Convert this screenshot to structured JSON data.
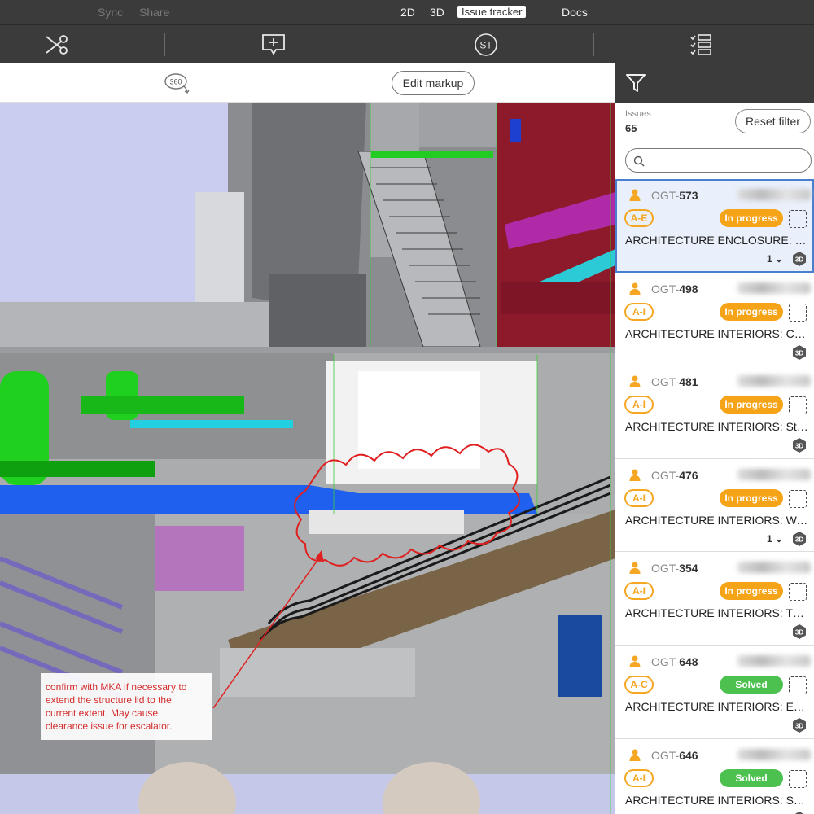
{
  "topnav": {
    "sync": "Sync",
    "share": "Share",
    "modes": [
      "2D",
      "3D",
      "Issue tracker",
      "Docs"
    ],
    "active_mode": "Issue tracker"
  },
  "toolbar": {
    "icons": [
      "scissors-icon",
      "add-comment-icon",
      "st-icon",
      "checklist-icon"
    ],
    "st_label": "ST"
  },
  "subbar": {
    "view360_label": "360",
    "edit_markup": "Edit markup"
  },
  "viewport": {
    "note_lines": [
      "confirm with MKA if necessary to",
      "extend the structure lid to the",
      "current extent. May cause",
      "clearance issue for escalator."
    ],
    "markup_color": "#e02020"
  },
  "panel": {
    "issues_label": "Issues",
    "issues_count": "65",
    "reset_filter": "Reset filter",
    "search_placeholder": "",
    "issues": [
      {
        "prefix": "OGT-",
        "number": "573",
        "category": "A-E",
        "status": "In progress",
        "title": "ARCHITECTURE ENCLOSURE: Stru...",
        "count": "1",
        "badge": "3D",
        "selected": true
      },
      {
        "prefix": "OGT-",
        "number": "498",
        "category": "A-I",
        "status": "In progress",
        "title": "ARCHITECTURE INTERIORS: Ceilin...",
        "count": "",
        "badge": "3D",
        "selected": false
      },
      {
        "prefix": "OGT-",
        "number": "481",
        "category": "A-I",
        "status": "In progress",
        "title": "ARCHITECTURE INTERIORS: Struc...",
        "count": "",
        "badge": "3D",
        "selected": false
      },
      {
        "prefix": "OGT-",
        "number": "476",
        "category": "A-I",
        "status": "In progress",
        "title": "ARCHITECTURE INTERIORS: Wall ...",
        "count": "1",
        "badge": "3D",
        "selected": false
      },
      {
        "prefix": "OGT-",
        "number": "354",
        "category": "A-I",
        "status": "In progress",
        "title": "ARCHITECTURE INTERIORS: TRUS...",
        "count": "",
        "badge": "3D",
        "selected": false
      },
      {
        "prefix": "OGT-",
        "number": "648",
        "category": "A-C",
        "status": "Solved",
        "title": "ARCHITECTURE INTERIORS: Encl...",
        "count": "",
        "badge": "3D",
        "selected": false
      },
      {
        "prefix": "OGT-",
        "number": "646",
        "category": "A-I",
        "status": "Solved",
        "title": "ARCHITECTURE INTERIORS: Soffit...",
        "count": "",
        "badge": "3D",
        "selected": false
      }
    ],
    "colors": {
      "in_progress": "#f5a317",
      "solved": "#4cc14f",
      "category": "#f5a623",
      "selection": "#4a7fd0"
    }
  }
}
